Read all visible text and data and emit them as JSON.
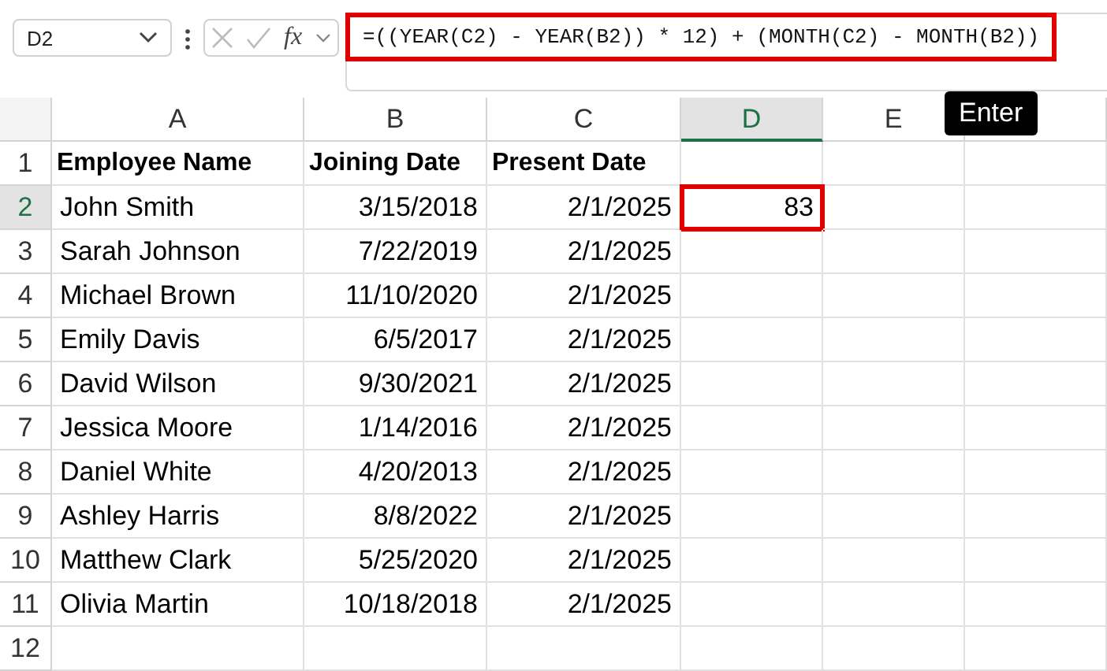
{
  "formula_bar": {
    "name_box": "D2",
    "formula": "=((YEAR(C2) - YEAR(B2)) * 12) + (MONTH(C2) - MONTH(B2))",
    "highlighted": true,
    "function_label": "fx"
  },
  "tooltip": "Enter",
  "columns": [
    {
      "label": "A",
      "selected": false
    },
    {
      "label": "B",
      "selected": false
    },
    {
      "label": "C",
      "selected": false
    },
    {
      "label": "D",
      "selected": true
    },
    {
      "label": "E",
      "selected": false
    }
  ],
  "rows": [
    {
      "number": "1",
      "kind": "header",
      "selected": false,
      "cells": [
        "Employee Name",
        "Joining Date",
        "Present Date"
      ]
    },
    {
      "number": "2",
      "kind": "data",
      "selected": true,
      "cells": [
        "John Smith",
        "3/15/2018",
        "2/1/2025",
        "83"
      ]
    },
    {
      "number": "3",
      "kind": "data",
      "selected": false,
      "cells": [
        "Sarah Johnson",
        "7/22/2019",
        "2/1/2025"
      ]
    },
    {
      "number": "4",
      "kind": "data",
      "selected": false,
      "cells": [
        "Michael Brown",
        "11/10/2020",
        "2/1/2025"
      ]
    },
    {
      "number": "5",
      "kind": "data",
      "selected": false,
      "cells": [
        "Emily Davis",
        "6/5/2017",
        "2/1/2025"
      ]
    },
    {
      "number": "6",
      "kind": "data",
      "selected": false,
      "cells": [
        "David Wilson",
        "9/30/2021",
        "2/1/2025"
      ]
    },
    {
      "number": "7",
      "kind": "data",
      "selected": false,
      "cells": [
        "Jessica Moore",
        "1/14/2016",
        "2/1/2025"
      ]
    },
    {
      "number": "8",
      "kind": "data",
      "selected": false,
      "cells": [
        "Daniel White",
        "4/20/2013",
        "2/1/2025"
      ]
    },
    {
      "number": "9",
      "kind": "data",
      "selected": false,
      "cells": [
        "Ashley Harris",
        "8/8/2022",
        "2/1/2025"
      ]
    },
    {
      "number": "10",
      "kind": "data",
      "selected": false,
      "cells": [
        "Matthew Clark",
        "5/25/2020",
        "2/1/2025"
      ]
    },
    {
      "number": "11",
      "kind": "data",
      "selected": false,
      "cells": [
        "Olivia Martin",
        "10/18/2018",
        "2/1/2025"
      ]
    },
    {
      "number": "12",
      "kind": "data",
      "selected": false,
      "cells": []
    }
  ]
}
